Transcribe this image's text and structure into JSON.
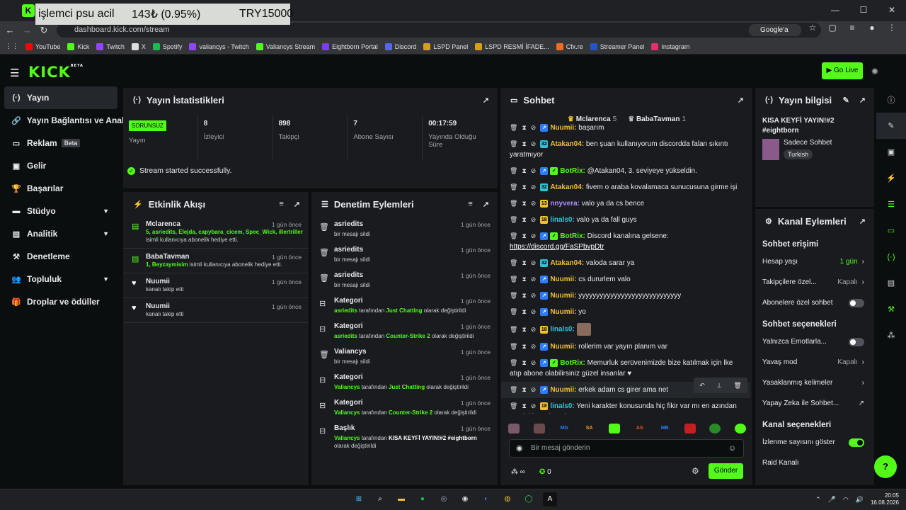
{
  "ticker": {
    "label": "işlemci psu acil",
    "price": "143₺ (0.95%)",
    "currency": "TRY15000"
  },
  "browser": {
    "url": "dashboard.kick.com/stream",
    "search_chip": "Google'a Sor",
    "window_min": "—",
    "window_max": "☐",
    "window_close": "✕",
    "bookmarks": [
      {
        "label": "YouTube",
        "color": "#ff0000"
      },
      {
        "label": "Kick",
        "color": "#53fc18"
      },
      {
        "label": "Twitch",
        "color": "#9146ff"
      },
      {
        "label": "X",
        "color": "#dddddd"
      },
      {
        "label": "Spotify",
        "color": "#1db954"
      },
      {
        "label": "valiancys - Twitch",
        "color": "#9146ff"
      },
      {
        "label": "Valiancys Stream",
        "color": "#53fc18"
      },
      {
        "label": "Eightborn Portal",
        "color": "#7a3cff"
      },
      {
        "label": "Discord",
        "color": "#5865f2"
      },
      {
        "label": "LSPD Panel",
        "color": "#d4a017"
      },
      {
        "label": "LSPD  RESMİ İFADE...",
        "color": "#d4a017"
      },
      {
        "label": "Cfx.re",
        "color": "#f36a24"
      },
      {
        "label": "Streamer Panel",
        "color": "#2255cc"
      },
      {
        "label": "Instagram",
        "color": "#e1306c"
      }
    ]
  },
  "kick": {
    "logo": "KICK",
    "logo_beta": "BETA",
    "golive": "Go Live"
  },
  "sidebar": [
    {
      "label": "Yayın",
      "icon": "broadcast-icon",
      "glyph": "(·)",
      "active": true
    },
    {
      "label": "Yayın Bağlantısı ve Anahtarı",
      "icon": "link-icon",
      "glyph": "🔗"
    },
    {
      "label": "Reklam",
      "icon": "ad-icon",
      "glyph": "▭",
      "badge": "Beta"
    },
    {
      "label": "Gelir",
      "icon": "wallet-icon",
      "glyph": "▣"
    },
    {
      "label": "Başarılar",
      "icon": "trophy-icon",
      "glyph": "🏆"
    },
    {
      "label": "Stüdyo",
      "icon": "studio-icon",
      "glyph": "▬",
      "chev": true
    },
    {
      "label": "Analitik",
      "icon": "chart-icon",
      "glyph": "▤",
      "chev": true
    },
    {
      "label": "Denetleme",
      "icon": "hammer-icon",
      "glyph": "⚒"
    },
    {
      "label": "Topluluk",
      "icon": "community-icon",
      "glyph": "👥",
      "chev": true
    },
    {
      "label": "Droplar ve ödüller",
      "icon": "drops-icon",
      "glyph": "🎁"
    }
  ],
  "stats": {
    "title": "Yayın İstatistikleri",
    "status_badge": "SORUNSUZ",
    "items": [
      {
        "value": "",
        "label": "Yayın"
      },
      {
        "value": "8",
        "label": "İzleyici"
      },
      {
        "value": "898",
        "label": "Takipçi"
      },
      {
        "value": "7",
        "label": "Abone Sayısı"
      },
      {
        "value": "00:17:59",
        "label": "Yayında Olduğu Süre"
      }
    ],
    "success": "Stream started successfully."
  },
  "activity": {
    "title": "Etkinlik Akışı",
    "items": [
      {
        "name": "Mclarenca",
        "time": "1 gün önce",
        "hi": "5, asriedits, Elejda, capybara_cicem, Spec_Wick, illertriller",
        "sub": "isimli kullanıcıya abonelik hediye etti."
      },
      {
        "name": "BabaTavman",
        "time": "1 gün önce",
        "hi": "1, Beyzaymisim",
        "sub": " isimli kullanıcıya abonelik hediye etti."
      },
      {
        "name": "Nuumii",
        "time": "1 gün önce",
        "hi": "",
        "sub": "kanalı takip etti"
      },
      {
        "name": "Nuumii",
        "time": "1 gün önce",
        "hi": "",
        "sub": "kanalı takip etti"
      }
    ]
  },
  "moderation": {
    "title": "Denetim Eylemleri",
    "items": [
      {
        "name": "asriedits",
        "time": "1 gün önce",
        "pre": "",
        "by": "",
        "mid": "bir mesajı sildi",
        "what": "",
        "post": ""
      },
      {
        "name": "asriedits",
        "time": "1 gün önce",
        "pre": "",
        "by": "",
        "mid": "bir mesajı sildi",
        "what": "",
        "post": ""
      },
      {
        "name": "asriedits",
        "time": "1 gün önce",
        "pre": "",
        "by": "",
        "mid": "bir mesajı sildi",
        "what": "",
        "post": ""
      },
      {
        "name": "Kategori",
        "time": "1 gün önce",
        "by": "asriedits",
        "mid": " tarafından ",
        "what": "Just Chatting",
        "post": " olarak değiştirildi"
      },
      {
        "name": "Kategori",
        "time": "1 gün önce",
        "by": "asriedits",
        "mid": " tarafından ",
        "what": "Counter-Strike 2",
        "post": " olarak değiştirildi"
      },
      {
        "name": "Valiancys",
        "time": "1 gün önce",
        "by": "",
        "mid": "bir mesajı sildi",
        "what": "",
        "post": ""
      },
      {
        "name": "Kategori",
        "time": "1 gün önce",
        "by": "Valiancys",
        "mid": " tarafından ",
        "what": "Just Chatting",
        "post": " olarak değiştirildi"
      },
      {
        "name": "Kategori",
        "time": "1 gün önce",
        "by": "Valiancys",
        "mid": " tarafından ",
        "what": "Counter-Strike 2",
        "post": " olarak değiştirildi"
      },
      {
        "name": "Başlık",
        "time": "1 gün önce",
        "by": "Valiancys",
        "mid": " tarafından ",
        "what": "KISA KEYFİ YAYIN!#2 #eightborn",
        "post": " olarak değiştirildi",
        "white": true
      }
    ]
  },
  "chat": {
    "title": "Sohbet",
    "gifters": [
      {
        "name": "Mclarenca",
        "count": "5"
      },
      {
        "name": "BabaTavman",
        "count": "1"
      }
    ],
    "messages": [
      {
        "user": "Nuumii:",
        "color": "#f0c030",
        "badge": "",
        "text": " başarım"
      },
      {
        "user": "Atakan04:",
        "color": "#f0c030",
        "badge": "32",
        "bcol": "#2ec4d6",
        "text": " ben şuan kullanıyorum discordda falan sıkıntı yaratmıyor"
      },
      {
        "user": "BotRix:",
        "color": "#53fc18",
        "badge": "B",
        "bcol": "#53fc18",
        "text": " @Atakan04, 3. seviyeye yükseldin."
      },
      {
        "user": "Atakan04:",
        "color": "#f0c030",
        "badge": "32",
        "bcol": "#2ec4d6",
        "text": " fivem o araba kovalamaca sunucusuna girme işi"
      },
      {
        "user": "nnyvera:",
        "color": "#b08cff",
        "badge": "13",
        "bcol": "#f0c030",
        "text": " valo ya da cs bence"
      },
      {
        "user": "linals0:",
        "color": "#2ec4d6",
        "badge": "18",
        "bcol": "#f0c030",
        "text": " valo ya da fall guys"
      },
      {
        "user": "BotRix:",
        "color": "#53fc18",
        "badge": "B",
        "bcol": "#53fc18",
        "text": " Discord kanalına gelsene: ",
        "link": "https://discord.gg/FaSPbvpDtr"
      },
      {
        "user": "Atakan04:",
        "color": "#f0c030",
        "badge": "32",
        "bcol": "#2ec4d6",
        "text": " valoda sarar ya"
      },
      {
        "user": "Nuumii:",
        "color": "#f0c030",
        "badge": "",
        "text": " cs dururlem valo"
      },
      {
        "user": "Nuumii:",
        "color": "#f0c030",
        "badge": "",
        "text": " yyyyyyyyyyyyyyyyyyyyyyyyyyyyy"
      },
      {
        "user": "Nuumii:",
        "color": "#f0c030",
        "badge": "",
        "text": " yo"
      },
      {
        "user": "linals0:",
        "color": "#2ec4d6",
        "badge": "18",
        "bcol": "#f0c030",
        "text": " ",
        "emote": true
      },
      {
        "user": "Nuumii:",
        "color": "#f0c030",
        "badge": "",
        "text": " rollerim var yayın planım var"
      },
      {
        "user": "BotRix:",
        "color": "#53fc18",
        "badge": "B",
        "bcol": "#53fc18",
        "text": " Memurluk serüvenimizde bize katılmak için lke atıp abone olabilirsiniz güzel insanlar ♥"
      },
      {
        "user": "Nuumii:",
        "color": "#f0c030",
        "badge": "",
        "text": " erkek adam cs girer ama net",
        "hl": true
      },
      {
        "user": "linals0:",
        "color": "#2ec4d6",
        "badge": "18",
        "bcol": "#f0c030",
        "text": " Yeni karakter konusunda hiç fikir var mı en azından mesleki versiyondan"
      }
    ],
    "input_placeholder": "Bir mesaj gönderin",
    "infinity": "∞",
    "points": "0",
    "send": "Gönder"
  },
  "info": {
    "title": "Yayın bilgisi",
    "stream_title": "KISA KEYFİ YAYIN!#2 #eightborn",
    "category": "Sadece Sohbet",
    "language": "Turkish"
  },
  "channel": {
    "title": "Kanal Eylemleri",
    "chat_access": "Sohbet erişimi",
    "account_age": {
      "label": "Hesap yaşı",
      "value": "1 gün"
    },
    "followers_only": {
      "label": "Takipçilere özel...",
      "value": "Kapalı"
    },
    "subs_only": {
      "label": "Abonelere özel sohbet"
    },
    "chat_options": "Sohbet seçenekleri",
    "emotes_only": {
      "label": "Yalnızca Emotlarla..."
    },
    "slow_mode": {
      "label": "Yavaş mod",
      "value": "Kapalı"
    },
    "banned_words": {
      "label": "Yasaklanmış kelimeler"
    },
    "ai_chat": {
      "label": "Yapay Zeka ile Sohbet..."
    },
    "channel_options": "Kanal seçenekleri",
    "show_viewers": {
      "label": "İzlenme sayısını göster"
    },
    "raid": {
      "label": "Raid Kanalı"
    }
  },
  "taskbar": {
    "time": "20:05",
    "date": "16.08.2026"
  }
}
